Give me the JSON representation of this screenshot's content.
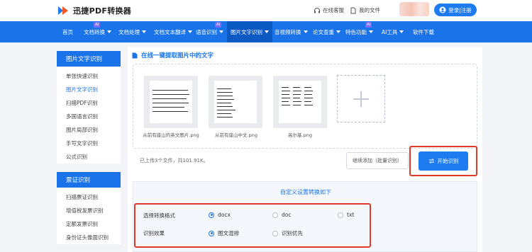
{
  "brand": {
    "name": "迅捷PDF转换器"
  },
  "topbar": {
    "service_label": "在线客服",
    "files_label": "我的文件",
    "login_label": "登录|注册"
  },
  "nav": {
    "items": [
      {
        "label": "首页"
      },
      {
        "label": "文档转换",
        "ai": "AI"
      },
      {
        "label": "文档处理"
      },
      {
        "label": "文档文本翻译"
      },
      {
        "label": "语音识别",
        "ai": "AI"
      },
      {
        "label": "图片文字识别"
      },
      {
        "label": "音视频转换"
      },
      {
        "label": "论文查重"
      },
      {
        "label": "特色功能",
        "ai": "AI"
      },
      {
        "label": "AI工具"
      },
      {
        "label": "软件下载"
      }
    ]
  },
  "sidebar": {
    "ocr_title": "图片文字识别",
    "ocr_items": [
      "单张快速识别",
      "图片文字识别",
      "扫描PDF识别",
      "多国语言识别",
      "图片局部识别",
      "手写文字识别",
      "公式识别"
    ],
    "ticket_title": "票证识别",
    "ticket_items": [
      "扫描票证识别",
      "增值税发票识别",
      "定额发票识别",
      "身份证头像面识别"
    ]
  },
  "main": {
    "section_title": "在线一键提取图片中的文字",
    "files": [
      {
        "name": "从前有座山的英文图片.png"
      },
      {
        "name": "从前有座山中文.png"
      },
      {
        "name": "高尔基.png"
      }
    ],
    "status": "已上传3个文件，共101.91K。",
    "continue_label": "继续添加（批量识别）",
    "start_label": "开始识别"
  },
  "settings": {
    "title": "自定义设置转换如下",
    "format_label": "选择转换格式",
    "format_options": [
      "docx",
      "doc",
      "txt"
    ],
    "format_selected": "docx",
    "effect_label": "识别效果",
    "effect_options": [
      "图文混排",
      "识别优先"
    ],
    "effect_selected": "图文混排"
  },
  "colors": {
    "primary": "#1a73e8",
    "nav_active": "#0c59c4",
    "highlight": "#e03a2a"
  }
}
